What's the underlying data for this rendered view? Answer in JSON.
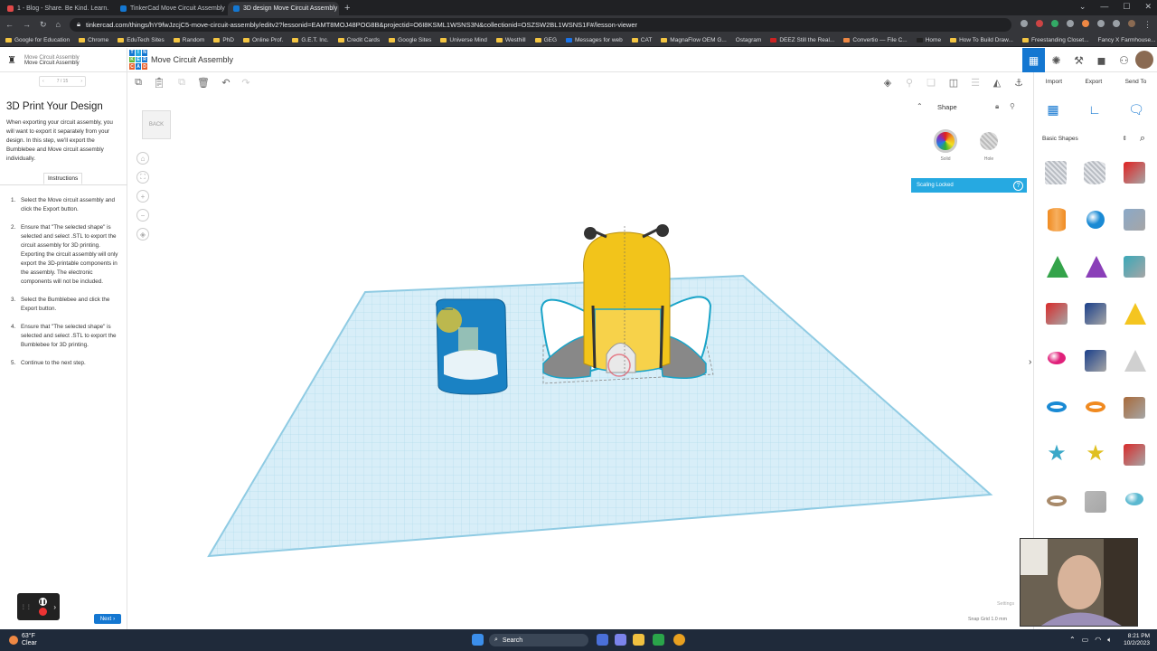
{
  "browser": {
    "tabs": [
      {
        "label": "1 - Blog - Share. Be Kind. Learn.",
        "active": false,
        "favicon_color": "#e04848"
      },
      {
        "label": "TinkerCad Move Circuit Assembly",
        "active": false,
        "favicon_color": "#1477d1"
      },
      {
        "label": "3D design Move Circuit Assembly",
        "active": true,
        "favicon_color": "#1477d1"
      }
    ],
    "url": "tinkercad.com/things/hY9fwJzcjC5-move-circuit-assembly/editv2?lessonid=EAMT8MOJ48POG8B&projectid=O6I8KSML1WSNS3N&collectionid=OSZSW2BL1WSNS1F#/lesson-viewer",
    "bookmarks": [
      "Google for Education",
      "Chrome",
      "EduTech Sites",
      "Random",
      "PhD",
      "Online Prof.",
      "G.E.T. Inc.",
      "Credit Cards",
      "Google Sites",
      "Universe Mind",
      "Westhill",
      "GEG",
      "Messages for web",
      "CAT",
      "MagnaFlow OEM G...",
      "Ostagram",
      "DEEZ Still the Real...",
      "Convertio — File C...",
      "Home",
      "How To Build Draw...",
      "Freestanding Closet...",
      "Fancy X Farmhouse..."
    ]
  },
  "header": {
    "lesson_label": "Move Circuit Assembly",
    "lesson_sublabel": "Move Circuit Assembly",
    "logo_letters": [
      "TIN",
      "KER",
      "CAD"
    ],
    "project_title": "Move Circuit Assembly"
  },
  "lesson": {
    "step_indicator": "7 / 15",
    "title": "3D Print Your Design",
    "intro": "When exporting your circuit assembly, you will want to export it separately from your design. In this step, we'll export the Bumblebee and Move circuit assembly individually.",
    "tab_label": "Instructions",
    "steps": [
      {
        "num": "1.",
        "text": "Select the Move circuit assembly and click the Export button."
      },
      {
        "num": "2.",
        "text": "Ensure that \"The selected shape\" is selected and select .STL to export the circuit assembly for 3D printing. Exporting the circuit assembly will only export the 3D-printable components in the assembly. The electronic components will not be included."
      },
      {
        "num": "3.",
        "text": "Select the Bumblebee and click the Export button."
      },
      {
        "num": "4.",
        "text": "Ensure that \"The selected shape\" is selected and select .STL to export the Bumblebee for 3D printing."
      },
      {
        "num": "5.",
        "text": "Continue to the next step."
      }
    ],
    "next_label": "Next"
  },
  "canvas": {
    "viewcube_label": "BACK",
    "inspector": {
      "title": "Shape",
      "solid_label": "Solid",
      "hole_label": "Hole",
      "scaling_locked": "Scaling Locked"
    },
    "settings_label": "Settings",
    "snap_grid_label": "Snap Grid",
    "snap_grid_value": "1.0 mm"
  },
  "right_panel": {
    "actions": [
      "Import",
      "Export",
      "Send To"
    ],
    "library_select": "Basic Shapes",
    "shapes": [
      {
        "name": "box-hole",
        "color": "#b8bcc2"
      },
      {
        "name": "cylinder-hole",
        "color": "#b8bcc2"
      },
      {
        "name": "box",
        "color": "#e02020"
      },
      {
        "name": "cylinder",
        "color": "#f08a20"
      },
      {
        "name": "sphere",
        "color": "#1a8ad4"
      },
      {
        "name": "scribble",
        "color": "#8aa8c8"
      },
      {
        "name": "roof",
        "color": "#34a34a"
      },
      {
        "name": "cone",
        "color": "#8a3fb8"
      },
      {
        "name": "round-roof",
        "color": "#3aa8b8"
      },
      {
        "name": "text",
        "color": "#d82a2a"
      },
      {
        "name": "wedge",
        "color": "#1a3f8a"
      },
      {
        "name": "pyramid",
        "color": "#f4c520"
      },
      {
        "name": "half-sphere",
        "color": "#e0207a"
      },
      {
        "name": "polygon",
        "color": "#1a3f8a"
      },
      {
        "name": "paraboloid",
        "color": "#d0d0d0"
      },
      {
        "name": "torus",
        "color": "#1a8ad4"
      },
      {
        "name": "tube",
        "color": "#f08a20"
      },
      {
        "name": "shape-generator",
        "color": "#a86a3a"
      },
      {
        "name": "star",
        "color": "#3aa8c8"
      },
      {
        "name": "star-gold",
        "color": "#e0c020"
      },
      {
        "name": "icosahedron",
        "color": "#d82a2a"
      },
      {
        "name": "ring",
        "color": "#a88a6a"
      },
      {
        "name": "dodecahedron",
        "color": "#b8b8b8"
      },
      {
        "name": "ellipsoid",
        "color": "#5ab8d0"
      }
    ]
  },
  "taskbar": {
    "temperature": "63°F",
    "weather": "Clear",
    "search_label": "Search",
    "time": "8:21 PM",
    "date": "10/2/2023"
  }
}
